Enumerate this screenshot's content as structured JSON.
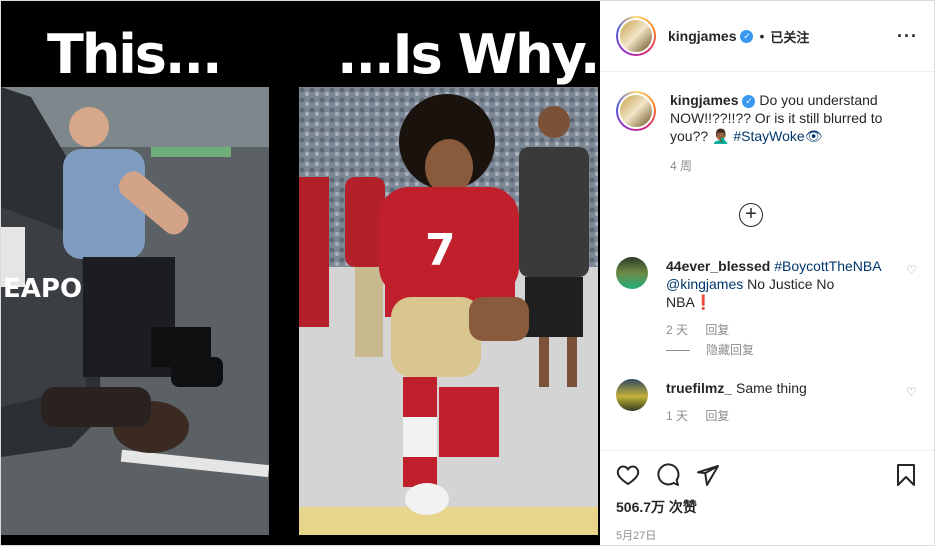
{
  "post": {
    "image": {
      "left_caption": "This...",
      "right_caption": "...Is Why."
    },
    "header": {
      "username": "kingjames",
      "follow_label": "已关注"
    },
    "caption": {
      "username": "kingjames",
      "text": "Do you understand NOW!!??!!?? Or is it still blurred to you?? 🤦🏾‍♂️ ",
      "hashtag": "#StayWoke👁",
      "time": "4 周"
    },
    "comments": [
      {
        "username": "44ever_blessed",
        "hashtag": "#BoycottTheNBA",
        "mention": "@kingjames",
        "text": "No Justice No NBA❗",
        "time": "2 天",
        "reply_label": "回复"
      },
      {
        "username": "truefilmz_",
        "text": "Same thing",
        "time": "1 天",
        "reply_label": "回复"
      }
    ],
    "hidden_replies_label": "隐藏回复",
    "likes": "506.7万 次赞",
    "date": "5月27日"
  },
  "icons": {
    "verified": "verified-badge-icon",
    "more": "more-options-icon",
    "load_more": "load-more-comments-icon",
    "like": "heart-icon",
    "comment": "comment-icon",
    "share": "share-icon",
    "save": "bookmark-icon"
  }
}
